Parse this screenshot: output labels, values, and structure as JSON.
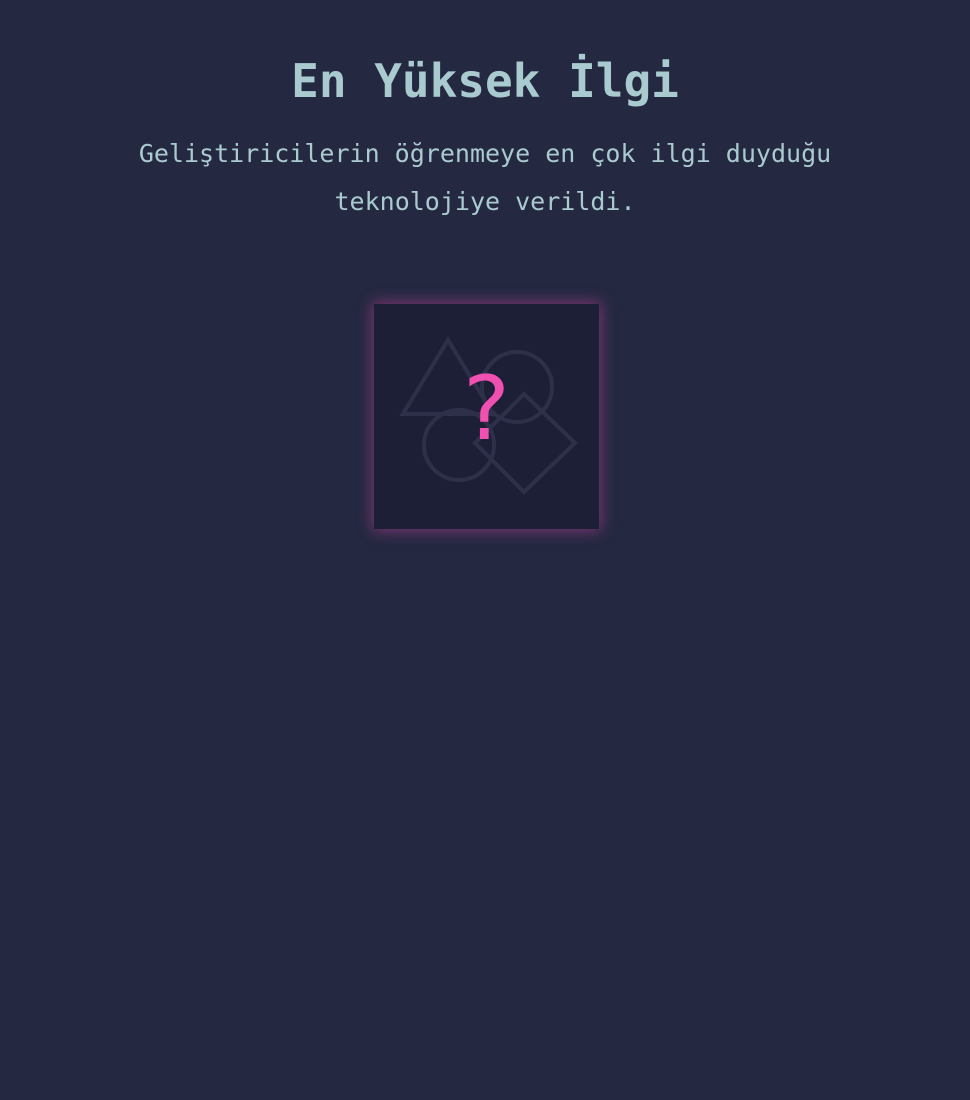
{
  "award": {
    "title": "En Yüksek İlgi",
    "description": "Geliştiricilerin öğrenmeye en çok ilgi duyduğu teknolojiye verildi.",
    "placeholder_symbol": "?",
    "placeholder_icon": "shapes-placeholder-icon"
  },
  "colors": {
    "background": "#242841",
    "text": "#a9cbd0",
    "badge_background": "#1d1f36",
    "accent": "#f050b0",
    "shape_outline": "#2d3048"
  }
}
